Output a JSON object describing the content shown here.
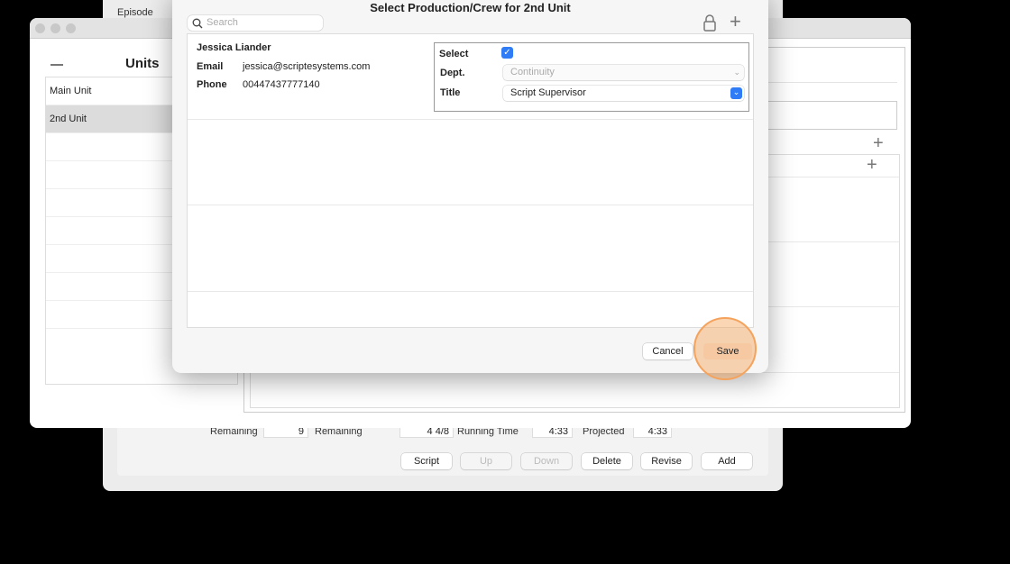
{
  "back_window": {
    "episode_label": "Episode",
    "stats": [
      {
        "label": "Remaining",
        "value": "9"
      },
      {
        "label": "Remaining",
        "value": "4 4/8"
      },
      {
        "label": "Running Time",
        "value": "4:33"
      },
      {
        "label": "Projected",
        "value": "4:33"
      }
    ],
    "buttons": [
      {
        "label": "Script",
        "enabled": true
      },
      {
        "label": "Up",
        "enabled": false
      },
      {
        "label": "Down",
        "enabled": false
      },
      {
        "label": "Delete",
        "enabled": true
      },
      {
        "label": "Revise",
        "enabled": true
      },
      {
        "label": "Add",
        "enabled": true
      }
    ]
  },
  "units_window": {
    "title": "Units",
    "remove_icon": "minus-icon",
    "add_icon": "plus-icon",
    "units": [
      "Main Unit",
      "2nd Unit"
    ],
    "selected": "2nd Unit"
  },
  "dialog": {
    "title": "Select Production/Crew for 2nd Unit",
    "search_placeholder": "Search",
    "lock_icon": "lock-icon",
    "add_icon": "plus-icon",
    "person": {
      "name": "Jessica Liander",
      "email_label": "Email",
      "email": "jessica@scriptesystems.com",
      "phone_label": "Phone",
      "phone": "00447437777140"
    },
    "select_label": "Select",
    "selected": true,
    "dept_label": "Dept.",
    "dept_value": "Continuity",
    "title_label": "Title",
    "title_value": "Script Supervisor",
    "cancel": "Cancel",
    "save": "Save"
  },
  "colors": {
    "accent": "#2f7cf6",
    "highlight": "#f5a35c"
  }
}
